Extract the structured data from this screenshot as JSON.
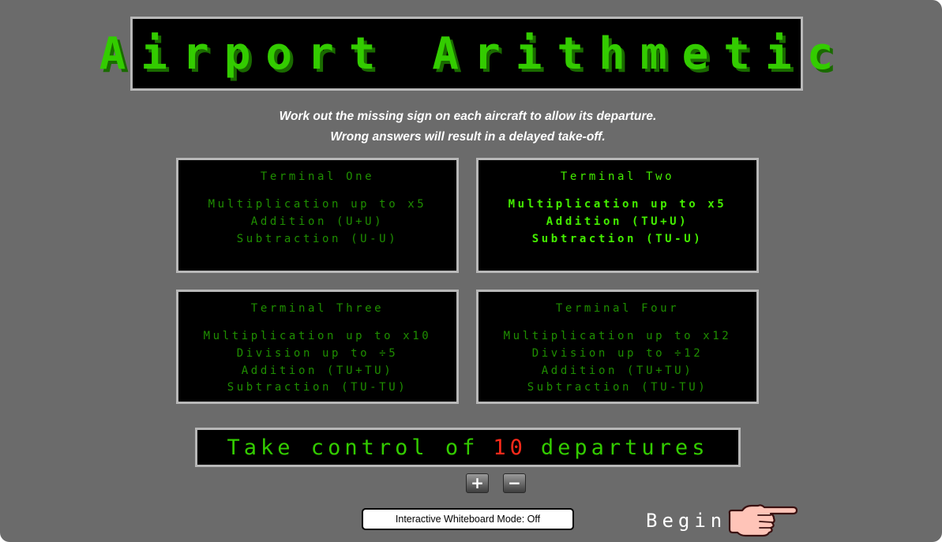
{
  "title": "Airport Arithmetic",
  "instructions": {
    "line1": "Work out the missing sign on each aircraft to allow its departure.",
    "line2": "Wrong answers will result in a delayed take-off."
  },
  "terminals": [
    {
      "name": "Terminal One",
      "lines": [
        "Multiplication up to x5",
        "Addition (U+U)",
        "Subtraction (U-U)"
      ],
      "selected": false
    },
    {
      "name": "Terminal Two",
      "lines": [
        "Multiplication up to x5",
        "Addition (TU+U)",
        "Subtraction (TU-U)"
      ],
      "selected": true
    },
    {
      "name": "Terminal Three",
      "lines": [
        "Multiplication up to x10",
        "Division up to ÷5",
        "Addition (TU+TU)",
        "Subtraction (TU-TU)"
      ],
      "selected": false
    },
    {
      "name": "Terminal Four",
      "lines": [
        "Multiplication up to x12",
        "Division up to ÷12",
        "Addition (TU+TU)",
        "Subtraction (TU-TU)"
      ],
      "selected": false
    }
  ],
  "departures": {
    "prefix": "Take control of",
    "count": "10",
    "suffix": "departures"
  },
  "controls": {
    "plus_label": "+",
    "minus_label": "−",
    "whiteboard_mode": "Interactive Whiteboard Mode: Off",
    "begin_label": "Begin",
    "begin_icon": "pointing-hand-icon"
  },
  "colors": {
    "background": "#6b6b6b",
    "board": "#000000",
    "led_green": "#33cc00",
    "led_dim": "#1f8f00",
    "count_red": "#ff2a1a"
  }
}
